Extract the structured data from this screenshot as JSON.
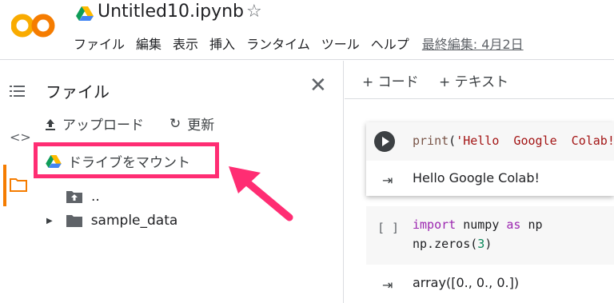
{
  "header": {
    "notebook_title": "Untitled10.ipynb",
    "logo_text": "CO",
    "menu": [
      "ファイル",
      "編集",
      "表示",
      "挿入",
      "ランタイム",
      "ツール",
      "ヘルプ"
    ],
    "last_edit": "最終編集: 4月2日"
  },
  "file_panel": {
    "title": "ファイル",
    "upload_label": "アップロード",
    "refresh_label": "更新",
    "mount_drive_label": "ドライブをマウント",
    "tree": [
      {
        "name": "..",
        "icon": "folder-up-icon"
      },
      {
        "name": "sample_data",
        "icon": "folder-icon"
      }
    ]
  },
  "toolbar": {
    "add_code": "+ コード",
    "add_text": "+ テキスト"
  },
  "cells": {
    "cell1": {
      "code_fn": "print",
      "code_open": "(",
      "code_str": "'Hello  Google  Colab!'",
      "code_close": ")",
      "output": "Hello Google Colab!"
    },
    "cell2": {
      "bracket": "[ ]",
      "line1_kw1": "import",
      "line1_mod": " numpy ",
      "line1_kw2": "as",
      "line1_alias": " np",
      "line2_prefix": "np.zeros(",
      "line2_num": "3",
      "line2_suffix": ")",
      "output": "array([0., 0., 0.])"
    }
  },
  "colors": {
    "accent_orange": "#f57c00",
    "highlight_pink": "#ff2d73"
  }
}
